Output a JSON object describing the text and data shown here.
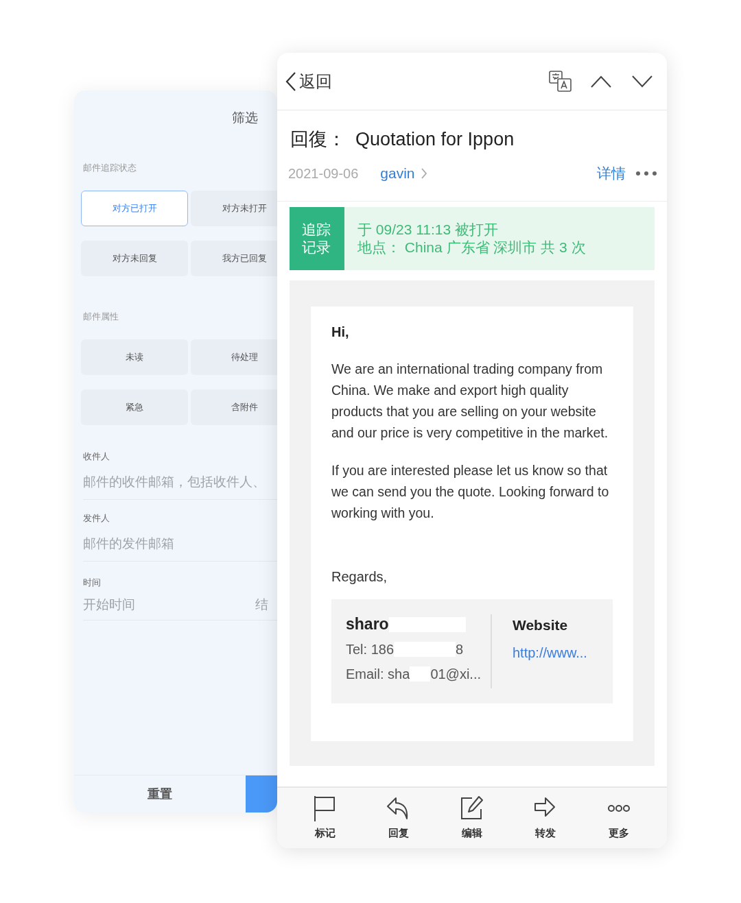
{
  "filter_panel": {
    "title": "筛选",
    "tracking": {
      "label": "邮件追踪状态",
      "options": [
        {
          "label": "对方已打开",
          "selected": true
        },
        {
          "label": "对方未打开",
          "selected": false
        },
        {
          "label": "对方未回复",
          "selected": false
        },
        {
          "label": "我方已回复",
          "selected": false
        }
      ]
    },
    "attributes": {
      "label": "邮件属性",
      "options": [
        {
          "label": "未读",
          "selected": false
        },
        {
          "label": "待处理",
          "selected": false
        },
        {
          "label": "紧急",
          "selected": false
        },
        {
          "label": "含附件",
          "selected": false
        }
      ]
    },
    "recipient": {
      "label": "收件人",
      "placeholder": "邮件的收件邮箱，包括收件人、"
    },
    "sender": {
      "label": "发件人",
      "placeholder": "邮件的发件邮箱"
    },
    "time": {
      "label": "时间",
      "start_placeholder": "开始时间",
      "end_placeholder": "结"
    },
    "reset_button": "重置"
  },
  "mail": {
    "back_label": "返回",
    "subject_prefix": "回復：",
    "subject": "Quotation for Ippon",
    "date": "2021-09-06",
    "sender": "gavin",
    "details_link": "详情",
    "tracking": {
      "badge": "追踪记录",
      "lines": [
        "于 09/23 11:13 被打开",
        "地点： China 广东省 深圳市 共 3 次"
      ]
    },
    "body": {
      "greeting": "Hi,",
      "paragraphs": [
        "We are an international trading company from China. We make and export high quality products that you are selling on your website and our price is very competitive in the market.",
        "If you are interested please let us know so that we can send you the quote. Looking forward to working with you."
      ],
      "closing": "Regards,"
    },
    "signature": {
      "name": "sharo",
      "tel_start": "Tel: 186",
      "tel_end": "8",
      "email_start": "Email: sha",
      "email_end": "01@xi...",
      "website_label": "Website",
      "website_link": "http://www..."
    },
    "toolbar": [
      {
        "kind": "flag",
        "label": "标记"
      },
      {
        "kind": "reply",
        "label": "回复"
      },
      {
        "kind": "edit",
        "label": "编辑"
      },
      {
        "kind": "forward",
        "label": "转发"
      },
      {
        "kind": "more",
        "label": "更多"
      }
    ]
  }
}
